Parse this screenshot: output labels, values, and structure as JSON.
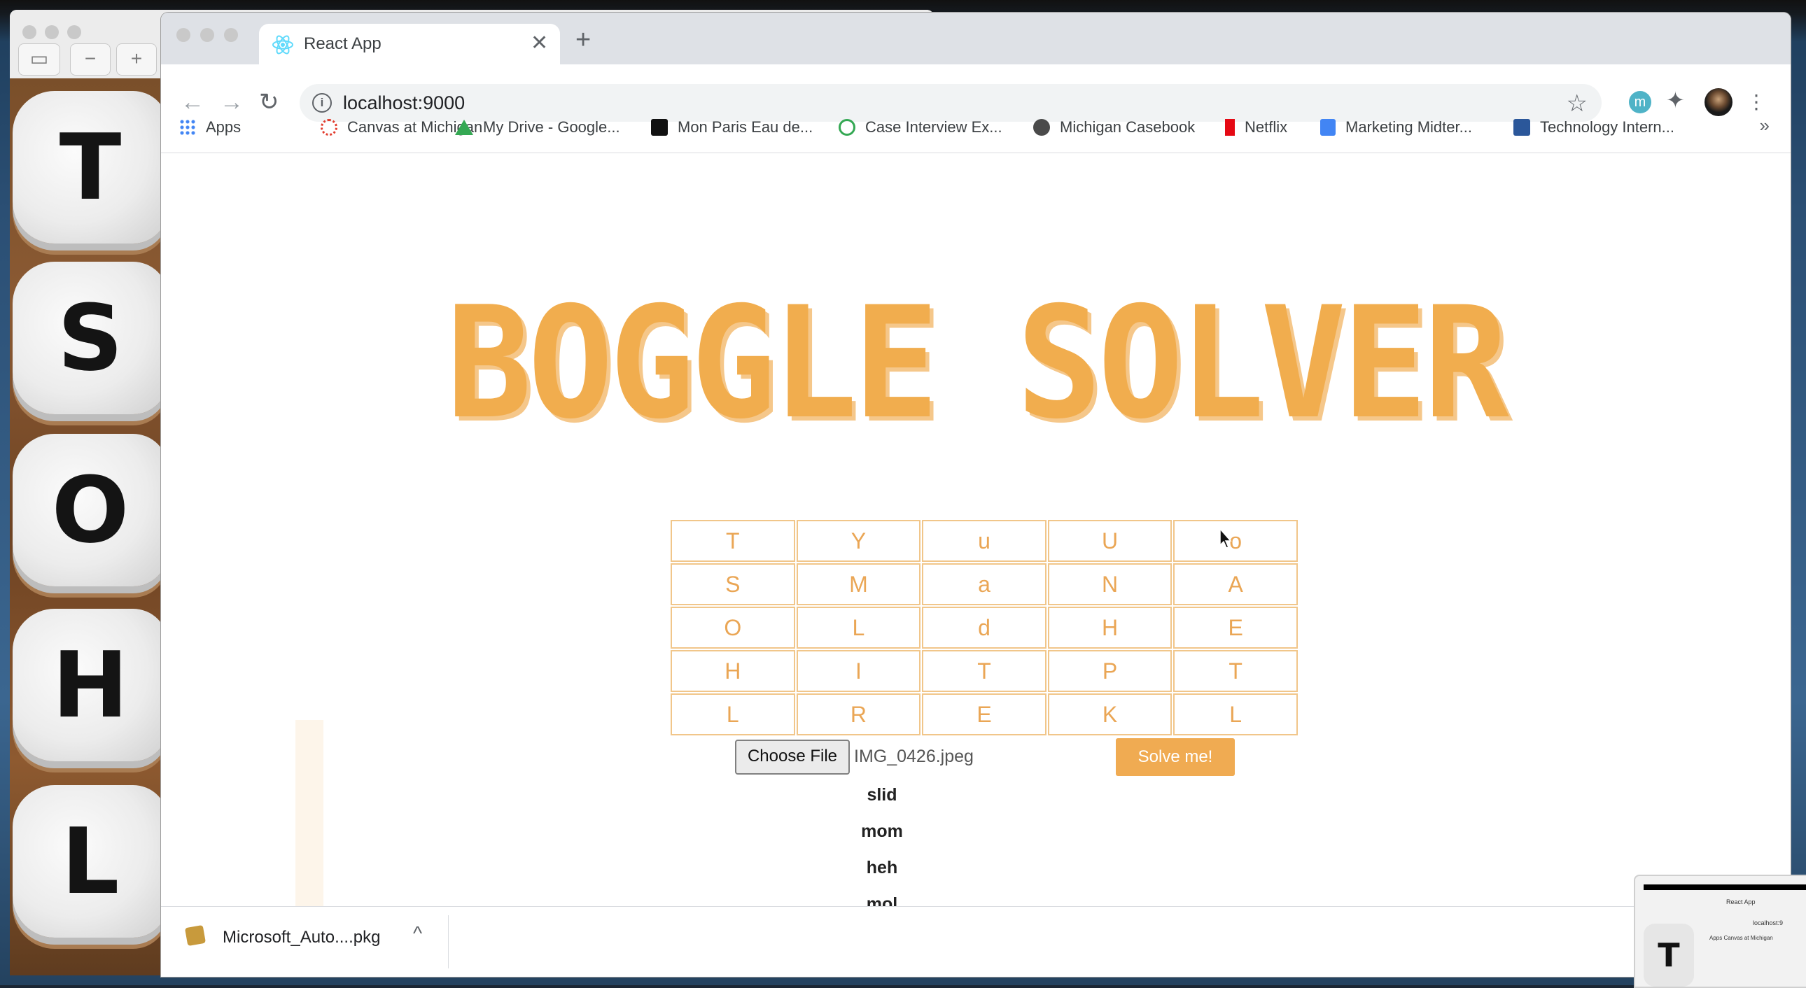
{
  "tab": {
    "title": "React App",
    "close": "✕",
    "new_tab": "+"
  },
  "nav": {
    "back": "←",
    "forward": "→",
    "reload": "↻"
  },
  "omnibox": {
    "info": "i",
    "url": "localhost:9000",
    "star": "☆"
  },
  "extensions": {
    "m_label": "m",
    "puzzle": "✦",
    "menu": "⋮"
  },
  "bookmarks": [
    {
      "label": "Apps",
      "icon": "apps-grid-icon",
      "color": "#4285f4"
    },
    {
      "label": "Canvas at Michigan",
      "icon": "canvas-icon",
      "color": "#e23c2e"
    },
    {
      "label": "My Drive - Google...",
      "icon": "google-drive-icon",
      "color": "#fbbc04"
    },
    {
      "label": "Mon Paris Eau de...",
      "icon": "brand-icon",
      "color": "#111111"
    },
    {
      "label": "Case Interview Ex...",
      "icon": "check-icon",
      "color": "#34a853"
    },
    {
      "label": "Michigan Casebook",
      "icon": "globe-icon",
      "color": "#3c4043"
    },
    {
      "label": "Netflix",
      "icon": "netflix-icon",
      "color": "#e50914"
    },
    {
      "label": "Marketing Midter...",
      "icon": "google-docs-icon",
      "color": "#4285f4"
    },
    {
      "label": "Technology Intern...",
      "icon": "word-icon",
      "color": "#2b579a"
    }
  ],
  "bookmarks_more": "»",
  "app": {
    "title": "BOGGLE SOLVER",
    "grid": [
      [
        "T",
        "Y",
        "u",
        "U",
        "o"
      ],
      [
        "S",
        "M",
        "a",
        "N",
        "A"
      ],
      [
        "O",
        "L",
        "d",
        "H",
        "E"
      ],
      [
        "H",
        "I",
        "T",
        "P",
        "T"
      ],
      [
        "L",
        "R",
        "E",
        "K",
        "L"
      ]
    ],
    "choose_file_label": "Choose File",
    "file_name": "IMG_0426.jpeg",
    "solve_label": "Solve me!",
    "words": [
      "slid",
      "mom",
      "heh",
      "mol"
    ],
    "accent_color": "#f0ab52"
  },
  "download": {
    "file": "Microsoft_Auto....pkg",
    "chevron": "^"
  },
  "background": {
    "dice": [
      "T",
      "S",
      "O",
      "H",
      "L"
    ]
  },
  "thumbnail": {
    "tab": "React App",
    "url": "localhost:9",
    "bookmark": "Apps   Canvas at Michigan",
    "die": "T"
  }
}
